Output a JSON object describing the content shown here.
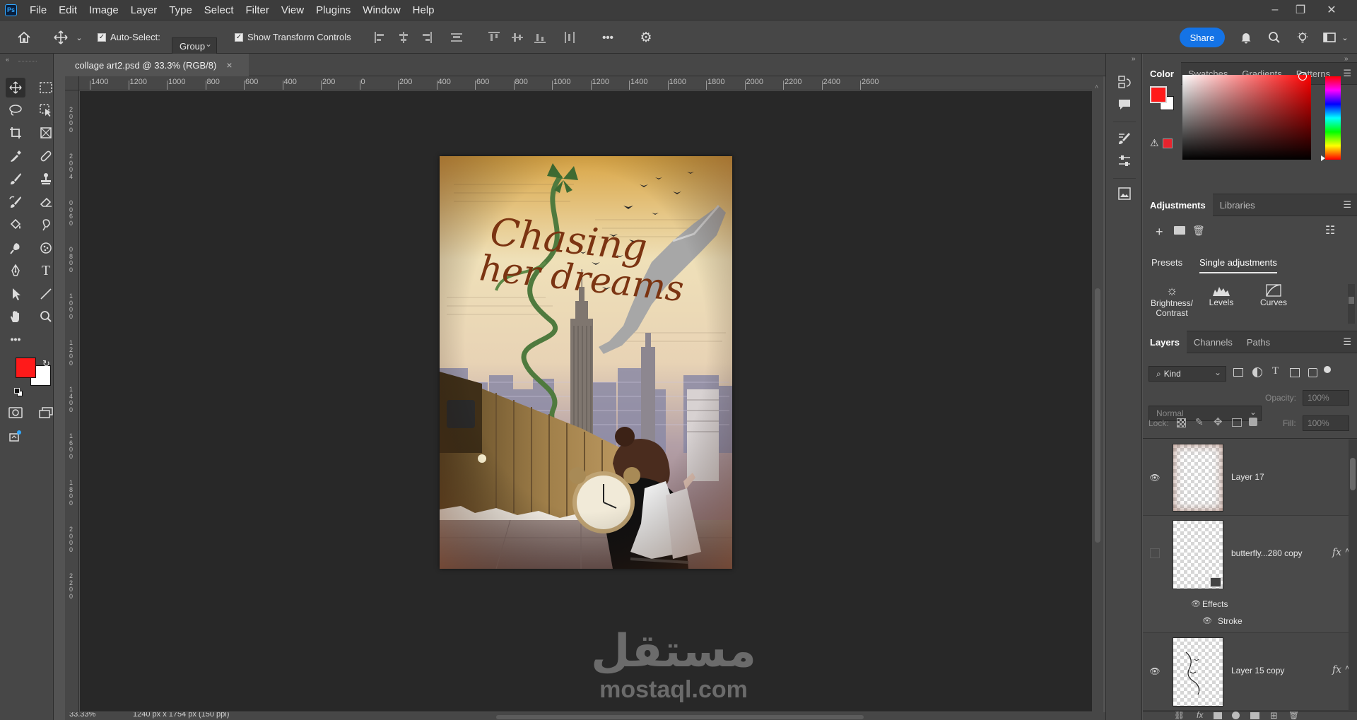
{
  "app": {
    "logo": "Ps",
    "menu": [
      "File",
      "Edit",
      "Image",
      "Layer",
      "Type",
      "Select",
      "Filter",
      "View",
      "Plugins",
      "Window",
      "Help"
    ],
    "window_controls": {
      "minimize": "–",
      "restore": "❐",
      "close": "✕"
    }
  },
  "options_bar": {
    "auto_select_label": "Auto-Select:",
    "auto_select_value": "Group",
    "show_transform_label": "Show Transform Controls",
    "more": "•••",
    "share_label": "Share"
  },
  "document": {
    "tab_title": "collage art2.psd @ 33.3% (RGB/8)",
    "close_glyph": "×",
    "status_zoom": "33.33%",
    "status_size": "1240 px x 1754 px (150 ppi)"
  },
  "rulers": {
    "top": [
      "1400",
      "1200",
      "1000",
      "800",
      "600",
      "400",
      "200",
      "0",
      "200",
      "400",
      "600",
      "800",
      "1000",
      "1200",
      "1400",
      "1600",
      "1800",
      "2000",
      "2200",
      "2400",
      "2600"
    ],
    "left": [
      "2",
      "0",
      "0",
      "0",
      "2",
      "0",
      "0",
      "4",
      "0",
      "0",
      "6",
      "0",
      "0",
      "8",
      "0",
      "0",
      "1",
      "0",
      "0",
      "0",
      "1",
      "2",
      "0",
      "0",
      "1",
      "4",
      "0",
      "0",
      "1",
      "6",
      "0",
      "0",
      "1",
      "8",
      "0",
      "0",
      "2",
      "0",
      "0",
      "0",
      "2",
      "2",
      "0",
      "0"
    ]
  },
  "artwork": {
    "title_line1": "Chasing",
    "title_line2": "her dreams"
  },
  "watermark": {
    "arabic": "مستقل",
    "latin": "mostaql.com"
  },
  "color_panel": {
    "tabs": [
      "Color",
      "Swatches",
      "Gradients",
      "Patterns"
    ],
    "foreground": "#ff1a1a",
    "background": "#ffffff"
  },
  "adjustments_panel": {
    "tabs": [
      "Adjustments",
      "Libraries"
    ],
    "subtabs": [
      "Presets",
      "Single adjustments"
    ],
    "items": [
      {
        "label_line1": "Brightness/",
        "label_line2": "Contrast",
        "icon": "brightness-icon"
      },
      {
        "label_line1": "Levels",
        "label_line2": "",
        "icon": "levels-icon"
      },
      {
        "label_line1": "Curves",
        "label_line2": "",
        "icon": "curves-icon"
      }
    ]
  },
  "layers_panel": {
    "tabs": [
      "Layers",
      "Channels",
      "Paths"
    ],
    "filter_kind": "Kind",
    "blend_mode": "Normal",
    "opacity_label": "Opacity:",
    "opacity_value": "100%",
    "lock_label": "Lock:",
    "fill_label": "Fill:",
    "fill_value": "100%",
    "layers": [
      {
        "name": "Layer 17",
        "visible": true,
        "fx": false
      },
      {
        "name": "butterfly...280 copy",
        "visible": false,
        "fx": true,
        "effects_label": "Effects",
        "effect": "Stroke"
      },
      {
        "name": "Layer 15 copy",
        "visible": true,
        "fx": true
      }
    ],
    "fx_glyph": "fx"
  }
}
